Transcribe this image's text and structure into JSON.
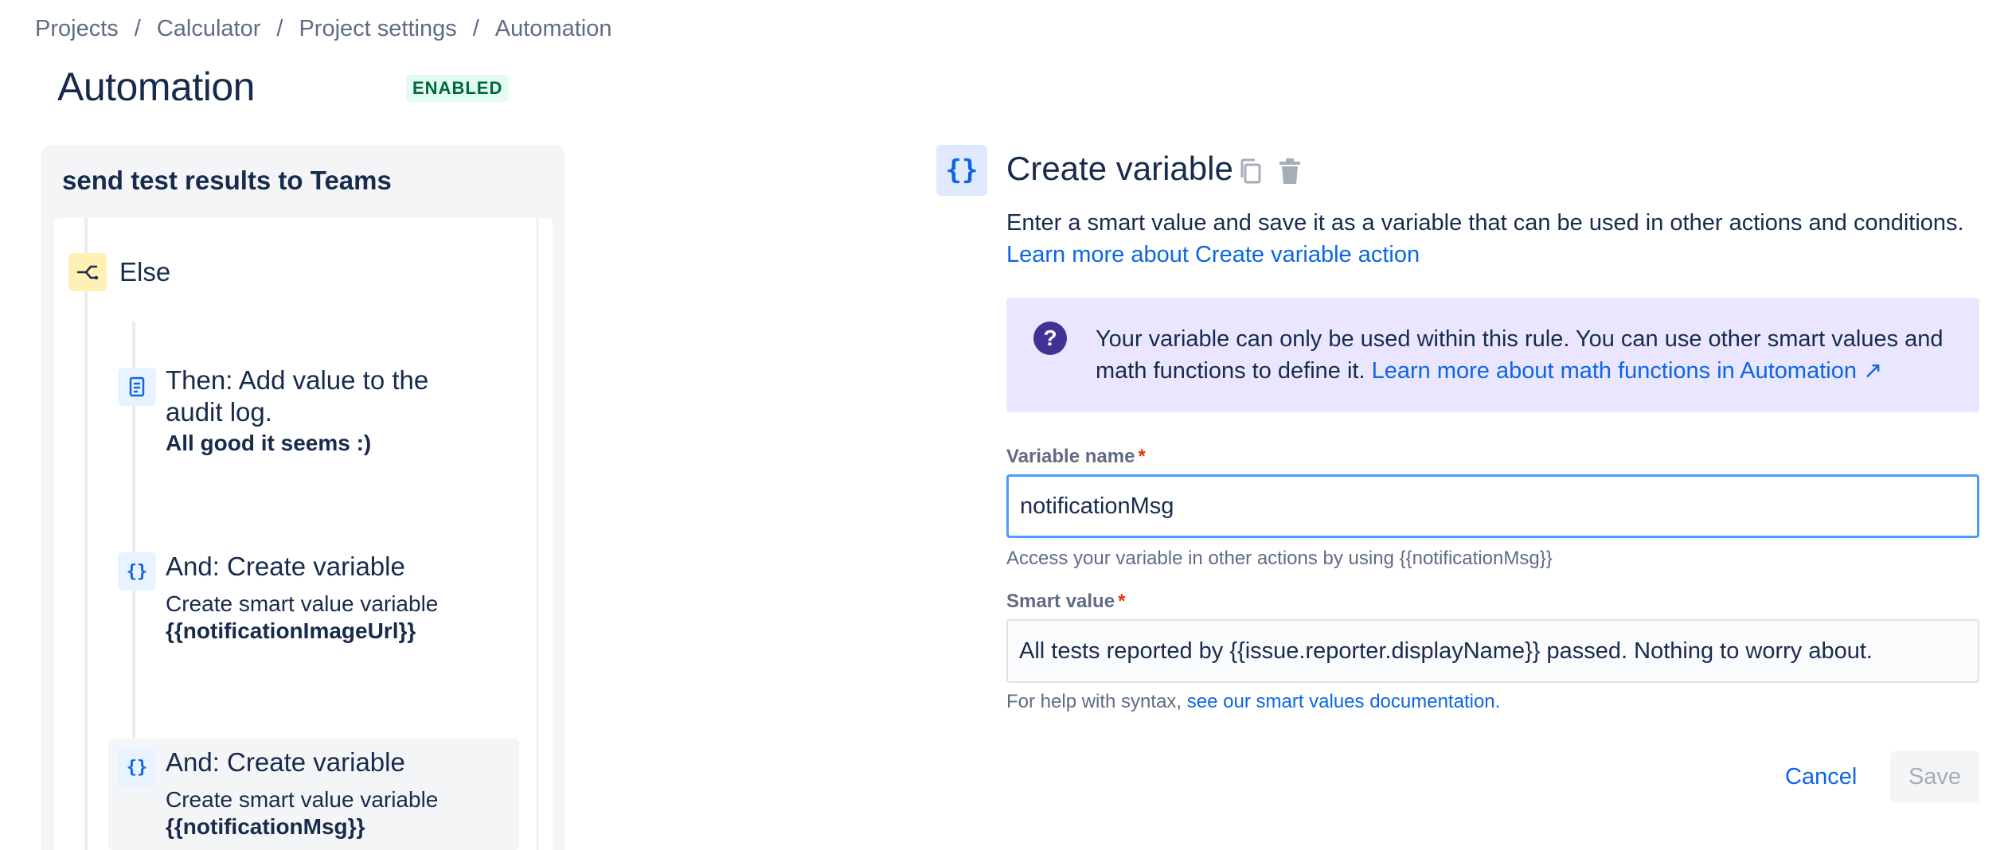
{
  "breadcrumb": [
    {
      "label": "Projects"
    },
    {
      "label": "Calculator"
    },
    {
      "label": "Project settings"
    },
    {
      "label": "Automation"
    }
  ],
  "breadcrumb_separator": "/",
  "page": {
    "title": "Automation",
    "status": "ENABLED"
  },
  "rule": {
    "name": "send test results to Teams",
    "else_label": "Else",
    "steps": [
      {
        "icon": "audit-log-icon",
        "title_line1": "Then: Add value to the",
        "title_line2": "audit log.",
        "detail": "All good it seems :)"
      },
      {
        "icon": "variable-icon",
        "icon_glyph": "{}",
        "title": "And: Create variable",
        "desc": "Create smart value variable",
        "detail": "{{notificationImageUrl}}"
      },
      {
        "icon": "variable-icon",
        "icon_glyph": "{}",
        "title": "And: Create variable",
        "desc": "Create smart value variable",
        "detail": "{{notificationMsg}}",
        "selected": true
      }
    ]
  },
  "detail": {
    "icon_glyph": "{}",
    "title": "Create variable",
    "description": "Enter a smart value and save it as a variable that can be used in other actions and conditions.",
    "learn_more": "Learn more about Create variable action",
    "info": {
      "text": "Your variable can only be used within this rule. You can use other smart values and math functions to define it.",
      "link": "Learn more about math functions in Automation ↗"
    },
    "variable_name": {
      "label": "Variable name",
      "required": "*",
      "value": "notificationMsg",
      "help": "Access your variable in other actions by using {{notificationMsg}}"
    },
    "smart_value": {
      "label": "Smart value",
      "required": "*",
      "value": "All tests reported by {{issue.reporter.displayName}} passed. Nothing to worry about.",
      "help_prefix": "For help with syntax,",
      "help_link": "see our smart values documentation."
    },
    "cancel_label": "Cancel",
    "save_label": "Save"
  },
  "colors": {
    "accent": "#0c66e4",
    "enabled_badge_bg": "#e3fcef",
    "enabled_badge_text": "#006644",
    "info_bg": "#eae6ff",
    "else_icon_bg": "#fff0b3",
    "required": "#de350b"
  }
}
